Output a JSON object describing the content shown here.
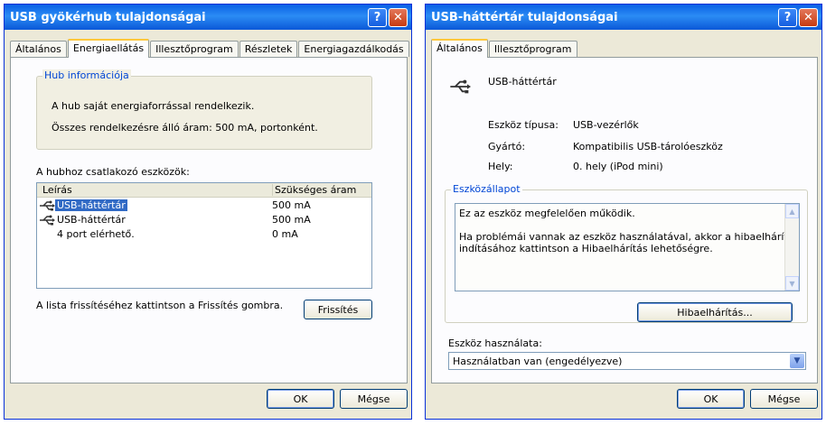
{
  "left_window": {
    "title": "USB gyökérhub tulajdonságai",
    "tabs": [
      "Általános",
      "Energiaellátás",
      "Illesztőprogram",
      "Részletek",
      "Energiagazdálkodás"
    ],
    "hub_group": {
      "title": "Hub információja",
      "line1": "A hub saját energiaforrással rendelkezik.",
      "line2": "Összes rendelkezésre álló áram:  500 mA, portonként."
    },
    "devices_label": "A hubhoz csatlakozó eszközök:",
    "list": {
      "col_desc": "Leírás",
      "col_current": "Szükséges áram",
      "rows": [
        {
          "desc": "USB-háttértár",
          "current": "500 mA"
        },
        {
          "desc": "USB-háttértár",
          "current": "500 mA"
        },
        {
          "desc": "4 port elérhető.",
          "current": "0 mA"
        }
      ]
    },
    "refresh_hint": "A lista frissítéséhez kattintson a Frissítés gombra.",
    "refresh_button": "Frissítés",
    "ok_button": "OK",
    "cancel_button": "Mégse"
  },
  "right_window": {
    "title": "USB-háttértár tulajdonságai",
    "tabs": [
      "Általános",
      "Illesztőprogram"
    ],
    "device_name": "USB-háttértár",
    "props": {
      "type_label": "Eszköz típusa:",
      "type_value": "USB-vezérlők",
      "maker_label": "Gyártó:",
      "maker_value": "Kompatibilis USB-tárolóeszköz",
      "location_label": "Hely:",
      "location_value": "0. hely (iPod mini)"
    },
    "status_group_title": "Eszközállapot",
    "status_line1": "Ez az eszköz megfelelően működik.",
    "status_line2": "Ha problémái vannak az eszköz használatával, akkor a hibaelhárító",
    "status_line3": "indításához kattintson a Hibaelhárítás lehetőségre.",
    "troubleshoot_button": "Hibaelhárítás...",
    "usage_label": "Eszköz használata:",
    "usage_value": "Használatban van (engedélyezve)",
    "ok_button": "OK",
    "cancel_button": "Mégse"
  }
}
